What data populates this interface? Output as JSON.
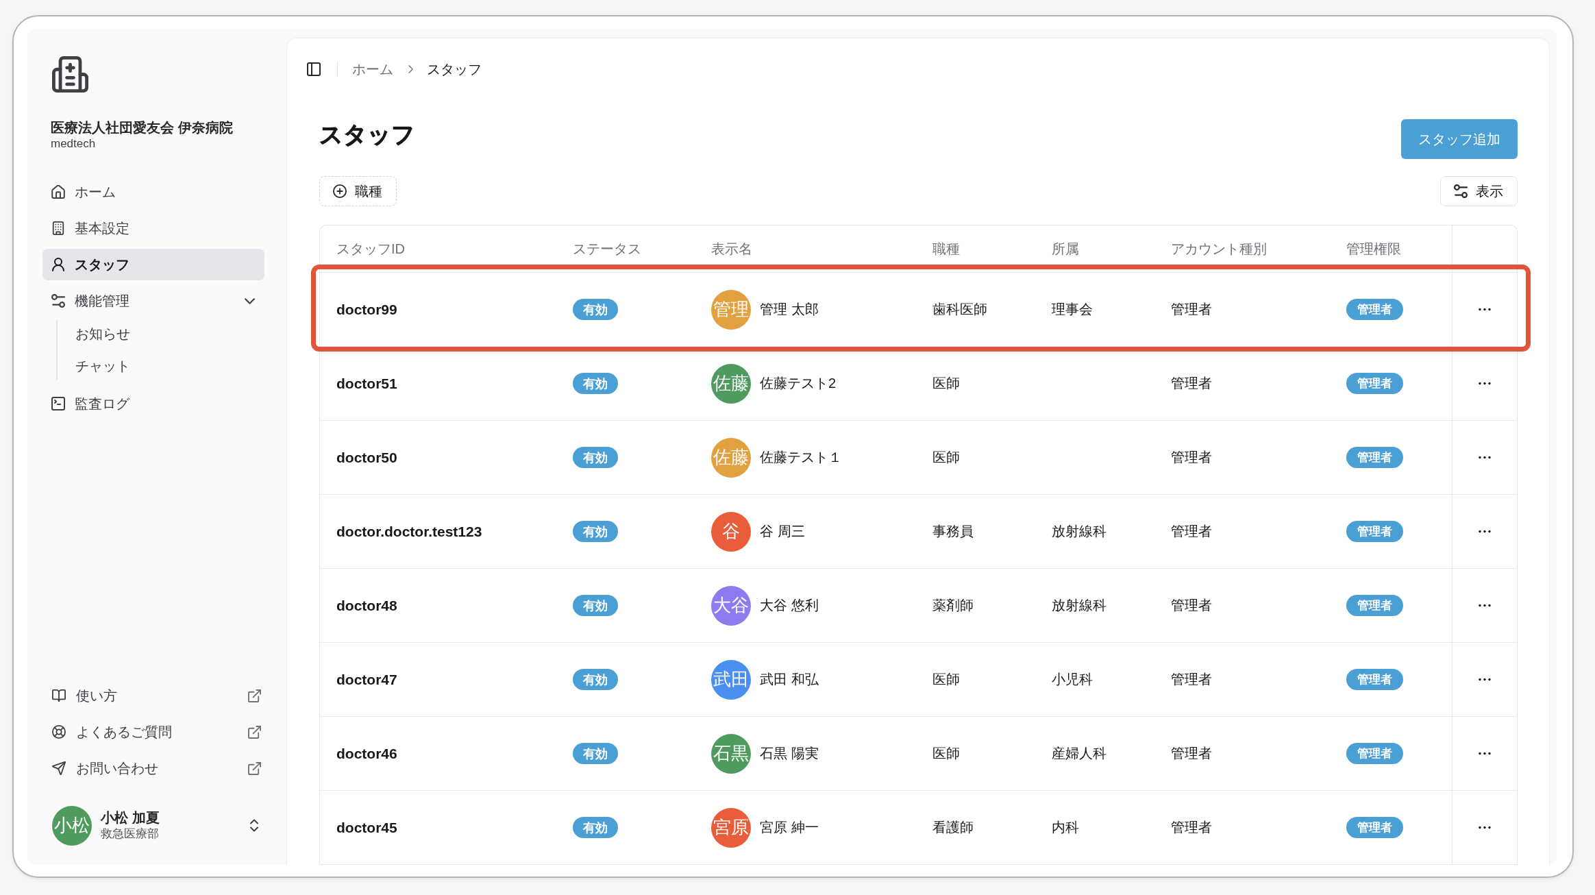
{
  "sidebar": {
    "organization": "医療法人社団愛友会 伊奈病院",
    "subtitle": "medtech",
    "nav": [
      {
        "kind": "link",
        "label": "ホーム",
        "selected": false
      },
      {
        "kind": "link",
        "label": "基本設定",
        "selected": false
      },
      {
        "kind": "link",
        "label": "スタッフ",
        "selected": true
      },
      {
        "kind": "group",
        "label": "機能管理",
        "selected": false,
        "expanded": true,
        "children": [
          {
            "label": "お知らせ",
            "selected": false
          },
          {
            "label": "チャット",
            "selected": false
          }
        ]
      },
      {
        "kind": "link",
        "label": "監査ログ",
        "selected": false
      }
    ],
    "help_links": [
      "使い方",
      "よくあるご質問",
      "お問い合わせ"
    ],
    "user": {
      "avatar_text": "小松",
      "name": "小松 加夏",
      "department": "救急医療部"
    }
  },
  "breadcrumb": [
    "ホーム",
    "スタッフ"
  ],
  "page_title": "スタッフ",
  "add_button": "スタッフ追加",
  "filter_button": "職種",
  "view_button": "表示",
  "table": {
    "columns": [
      "スタッフID",
      "ステータス",
      "表示名",
      "職種",
      "所属",
      "アカウント種別",
      "管理権限"
    ],
    "rows": [
      {
        "staff_id": "doctor99",
        "status": "有効",
        "avatar_text": "管理",
        "color": "#e2a03f",
        "display_name": "管理 太郎",
        "job_type": "歯科医師",
        "department": "理事会",
        "account_type": "管理者",
        "admin_role": "管理者",
        "highlighted": true
      },
      {
        "staff_id": "doctor51",
        "status": "有効",
        "avatar_text": "佐藤",
        "color": "#4e9a5f",
        "display_name": "佐藤テスト2",
        "job_type": "医師",
        "account_type": "管理者",
        "admin_role": "管理者",
        "highlighted": false
      },
      {
        "staff_id": "doctor50",
        "status": "有効",
        "avatar_text": "佐藤",
        "color": "#e2a03f",
        "display_name": "佐藤テスト１",
        "job_type": "医師",
        "account_type": "管理者",
        "admin_role": "管理者",
        "highlighted": false
      },
      {
        "staff_id": "doctor.doctor.test123",
        "status": "有効",
        "avatar_text": "谷",
        "color": "#e95d3b",
        "display_name": "谷 周三",
        "job_type": "事務員",
        "department": "放射線科",
        "account_type": "管理者",
        "admin_role": "管理者",
        "highlighted": false
      },
      {
        "staff_id": "doctor48",
        "status": "有効",
        "avatar_text": "大谷",
        "color": "#8c7cf0",
        "display_name": "大谷 悠利",
        "job_type": "薬剤師",
        "department": "放射線科",
        "account_type": "管理者",
        "admin_role": "管理者",
        "highlighted": false
      },
      {
        "staff_id": "doctor47",
        "status": "有効",
        "avatar_text": "武田",
        "color": "#4a8ef0",
        "display_name": "武田 和弘",
        "job_type": "医師",
        "department": "小児科",
        "account_type": "管理者",
        "admin_role": "管理者",
        "highlighted": false
      },
      {
        "staff_id": "doctor46",
        "status": "有効",
        "avatar_text": "石黒",
        "color": "#4e9a5f",
        "display_name": "石黒 陽実",
        "job_type": "医師",
        "department": "産婦人科",
        "account_type": "管理者",
        "admin_role": "管理者",
        "highlighted": false
      },
      {
        "staff_id": "doctor45",
        "status": "有効",
        "avatar_text": "宮原",
        "color": "#e95d3b",
        "display_name": "宮原 紳一",
        "job_type": "看護師",
        "department": "内科",
        "account_type": "管理者",
        "admin_role": "管理者",
        "highlighted": false
      }
    ]
  }
}
